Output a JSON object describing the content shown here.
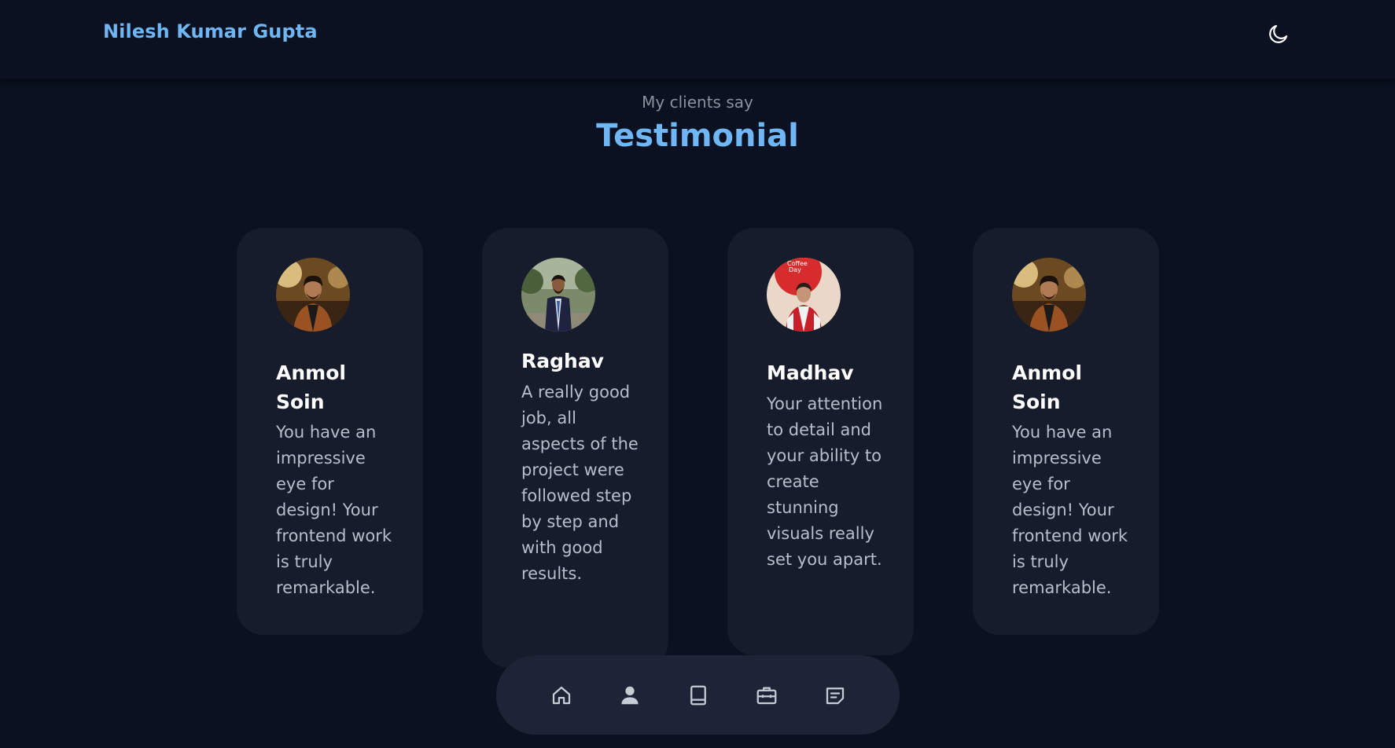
{
  "header": {
    "brand": "Nilesh Kumar Gupta",
    "theme_toggle_icon": "moon-icon"
  },
  "section": {
    "subtitle": "My clients say",
    "title": "Testimonial"
  },
  "testimonials": [
    {
      "name": "Anmol Soin",
      "text": "You have an impressive eye for design! Your frontend work is truly remarkable.",
      "avatar": "avatar-photo"
    },
    {
      "name": "Raghav",
      "text": "A really good job, all aspects of the project were followed step by step and with good results.",
      "avatar": "avatar-photo"
    },
    {
      "name": "Madhav",
      "text": "Your attention to detail and your ability to create stunning visuals really set you apart.",
      "avatar": "avatar-photo"
    },
    {
      "name": "Anmol Soin",
      "text": "You have an impressive eye for design! Your frontend work is truly remarkable.",
      "avatar": "avatar-photo"
    }
  ],
  "bottom_nav": {
    "items": [
      "home-icon",
      "user-icon",
      "book-icon",
      "briefcase-icon",
      "message-icon"
    ]
  },
  "colors": {
    "background": "#0b1120",
    "card": "#161c2b",
    "accent": "#6eb6f4",
    "nav": "#1d2435"
  }
}
